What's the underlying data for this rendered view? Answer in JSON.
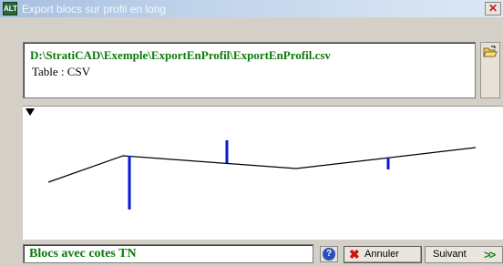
{
  "window": {
    "title": "Export blocs sur profil en long",
    "app_icon_text": "ALT",
    "close_symbol": "✕"
  },
  "file": {
    "path": "D:\\StratiCAD\\Exemple\\ExportEnProfil\\ExportEnProfil.csv",
    "table_info": "Table : CSV"
  },
  "footer": {
    "status_label": "Blocs avec cotes TN",
    "help_symbol": "?",
    "cancel_icon": "✖",
    "cancel_label": "Annuler",
    "next_label": "Suivant",
    "next_icon": ">>"
  },
  "colors": {
    "profile_line": "#000000",
    "blocks": "#0a1ad8",
    "status_text": "#0a7a0a"
  }
}
